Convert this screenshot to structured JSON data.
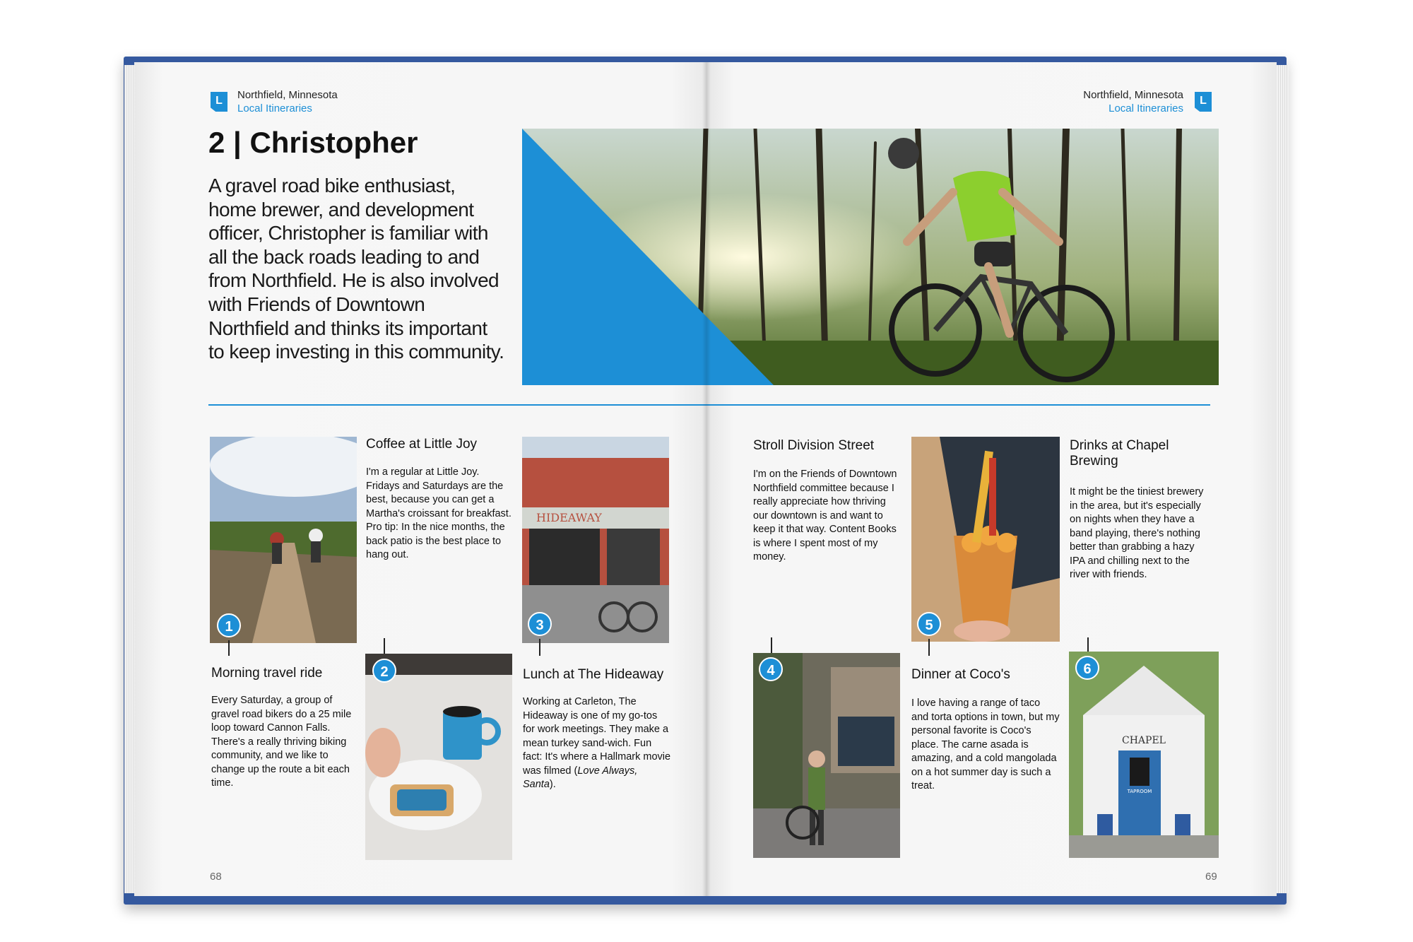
{
  "header": {
    "logo_letter": "L",
    "location": "Northfield, Minnesota",
    "section": "Local Itineraries"
  },
  "chapter": {
    "title": "2 | Christopher",
    "intro": "A gravel road bike enthusiast, home brewer, and development officer, Christopher is familiar with all the back roads leading to and from Northfield.  He is also involved with Friends of Downtown Northfield and thinks its important to keep investing in this community."
  },
  "stops": [
    {
      "number": "1",
      "title": "Morning travel ride",
      "text": "Every Saturday, a group of gravel road bikers do a 25 mile loop toward Cannon Falls. There's a really thriving biking community, and we like to change up the route a bit each time."
    },
    {
      "number": "2",
      "title": "Coffee at Little Joy",
      "text": "I'm a regular at Little Joy. Fridays and Saturdays are the best, because you can get a Martha's croissant for breakfast. Pro tip: In the nice months, the back patio is the best place to hang out."
    },
    {
      "number": "3",
      "title": "Lunch at The Hideaway",
      "text": "Working at Carleton, The Hideaway is one of my go-tos for work meetings. They make a mean turkey sand-wich. Fun fact: It's where a Hallmark movie was filmed",
      "text_em": "Love Always, Santa",
      "text_pre": " (",
      "text_post": ")."
    },
    {
      "number": "4",
      "title": "Stroll Division Street",
      "text": "I'm on the Friends of Downtown Northfield committee because I really appreciate how thriving our downtown is and want to keep it that way. Content Books is where I spent most of my money."
    },
    {
      "number": "5",
      "title": "Dinner at Coco's",
      "text": "I love having a range of taco and torta options in town, but my personal favorite is Coco's place. The carne asada is amazing, and a cold mangolada on a hot summer day is such a treat."
    },
    {
      "number": "6",
      "title": "Drinks at Chapel Brewing",
      "text": "It might be the tiniest brewery in the area, but it's especially on nights when they have a band playing, there's nothing better than grabbing a hazy IPA and chilling next to the river with friends."
    }
  ],
  "photo_text": {
    "hideaway_sign": "HIDEAWAY",
    "chapel_sign": "CHAPEL",
    "taproom_sign": "TAPROOM"
  },
  "pages": {
    "left": "68",
    "right": "69"
  },
  "colors": {
    "accent": "#1d8fd6",
    "cover": "#35599f"
  }
}
